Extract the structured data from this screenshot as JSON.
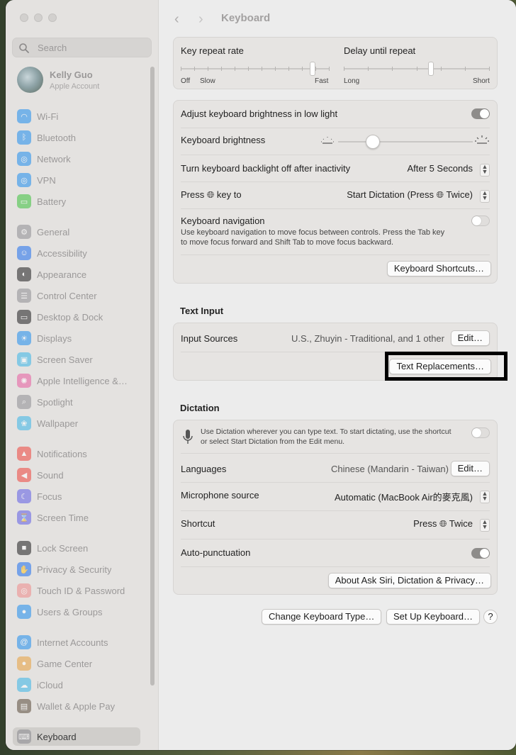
{
  "sidebar": {
    "search_placeholder": "Search",
    "account": {
      "name": "Kelly Guo",
      "subtitle": "Apple Account"
    },
    "items": [
      {
        "label": "Wi-Fi",
        "icon": "wifi-icon",
        "color": "#1e8ef0"
      },
      {
        "label": "Bluetooth",
        "icon": "bluetooth-icon",
        "color": "#1e8ef0"
      },
      {
        "label": "Network",
        "icon": "globe-icon",
        "color": "#1e8ef0"
      },
      {
        "label": "VPN",
        "icon": "vpn-icon",
        "color": "#1e8ef0"
      },
      {
        "label": "Battery",
        "icon": "battery-icon",
        "color": "#3cc23c"
      },
      {
        "label": "General",
        "icon": "gear-icon",
        "color": "#8e8e93"
      },
      {
        "label": "Accessibility",
        "icon": "accessibility-icon",
        "color": "#1e6ef0"
      },
      {
        "label": "Appearance",
        "icon": "appearance-icon",
        "color": "#1d1d1f"
      },
      {
        "label": "Control Center",
        "icon": "control-center-icon",
        "color": "#8e8e93"
      },
      {
        "label": "Desktop & Dock",
        "icon": "dock-icon",
        "color": "#1d1d1f"
      },
      {
        "label": "Displays",
        "icon": "sun-icon",
        "color": "#1e8ef0"
      },
      {
        "label": "Screen Saver",
        "icon": "screen-saver-icon",
        "color": "#38b6e8"
      },
      {
        "label": "Apple Intelligence &…",
        "icon": "apple-intelligence-icon",
        "color": "#e85aa0"
      },
      {
        "label": "Spotlight",
        "icon": "spotlight-icon",
        "color": "#8e8e93"
      },
      {
        "label": "Wallpaper",
        "icon": "wallpaper-icon",
        "color": "#38b6e8"
      },
      {
        "label": "Notifications",
        "icon": "bell-icon",
        "color": "#f0443c"
      },
      {
        "label": "Sound",
        "icon": "speaker-icon",
        "color": "#f0443c"
      },
      {
        "label": "Focus",
        "icon": "moon-icon",
        "color": "#5e5ce6"
      },
      {
        "label": "Screen Time",
        "icon": "hourglass-icon",
        "color": "#5e5ce6"
      },
      {
        "label": "Lock Screen",
        "icon": "lock-icon",
        "color": "#1d1d1f"
      },
      {
        "label": "Privacy & Security",
        "icon": "hand-icon",
        "color": "#1e6ef0"
      },
      {
        "label": "Touch ID & Password",
        "icon": "fingerprint-icon",
        "color": "#f08a8a"
      },
      {
        "label": "Users & Groups",
        "icon": "users-icon",
        "color": "#1e8ef0"
      },
      {
        "label": "Internet Accounts",
        "icon": "at-icon",
        "color": "#1e8ef0"
      },
      {
        "label": "Game Center",
        "icon": "game-center-icon",
        "color": "#e8a03c"
      },
      {
        "label": "iCloud",
        "icon": "cloud-icon",
        "color": "#38b6e8"
      },
      {
        "label": "Wallet & Apple Pay",
        "icon": "wallet-icon",
        "color": "#5a4a3a"
      },
      {
        "label": "Keyboard",
        "icon": "keyboard-icon",
        "color": "#8e8e93"
      }
    ]
  },
  "header": {
    "title": "Keyboard"
  },
  "repeat": {
    "key_repeat_label": "Key repeat rate",
    "key_repeat_left": "Off",
    "key_repeat_left2": "Slow",
    "key_repeat_right": "Fast",
    "key_repeat_value": 0.9,
    "delay_label": "Delay until repeat",
    "delay_left": "Long",
    "delay_right": "Short",
    "delay_value": 0.6
  },
  "brightness": {
    "adjust_label": "Adjust keyboard brightness in low light",
    "adjust_on": true,
    "brightness_label": "Keyboard brightness",
    "brightness_value": 0.23,
    "backlight_label": "Turn keyboard backlight off after inactivity",
    "backlight_value": "After 5 Seconds",
    "press_key_prefix": "Press",
    "press_key_suffix": "key to",
    "press_key_value_pre": "Start Dictation (Press",
    "press_key_value_post": "Twice)",
    "navigation_label": "Keyboard navigation",
    "navigation_desc_line1": "Use keyboard navigation to move focus between controls. Press the Tab key",
    "navigation_desc_line2": "to move focus forward and Shift Tab to move focus backward.",
    "navigation_on": false,
    "shortcuts_button": "Keyboard Shortcuts…"
  },
  "text_input": {
    "section_title": "Text Input",
    "input_sources_label": "Input Sources",
    "input_sources_value": "U.S., Zhuyin - Traditional, and 1 other",
    "edit_button": "Edit…",
    "text_replacements_button": "Text Replacements…"
  },
  "dictation": {
    "section_title": "Dictation",
    "desc_line1": "Use Dictation wherever you can type text. To start dictating, use the shortcut",
    "desc_line2": "or select Start Dictation from the Edit menu.",
    "dictation_on": false,
    "languages_label": "Languages",
    "languages_value": "Chinese (Mandarin - Taiwan)",
    "languages_edit": "Edit…",
    "mic_label": "Microphone source",
    "mic_value": "Automatic (MacBook Air的麥克風)",
    "shortcut_label": "Shortcut",
    "shortcut_value_pre": "Press",
    "shortcut_value_post": "Twice",
    "autopunct_label": "Auto-punctuation",
    "autopunct_on": true,
    "about_button": "About Ask Siri, Dictation & Privacy…"
  },
  "footer": {
    "change_type_button": "Change Keyboard Type…",
    "setup_button": "Set Up Keyboard…",
    "help_button": "?"
  }
}
